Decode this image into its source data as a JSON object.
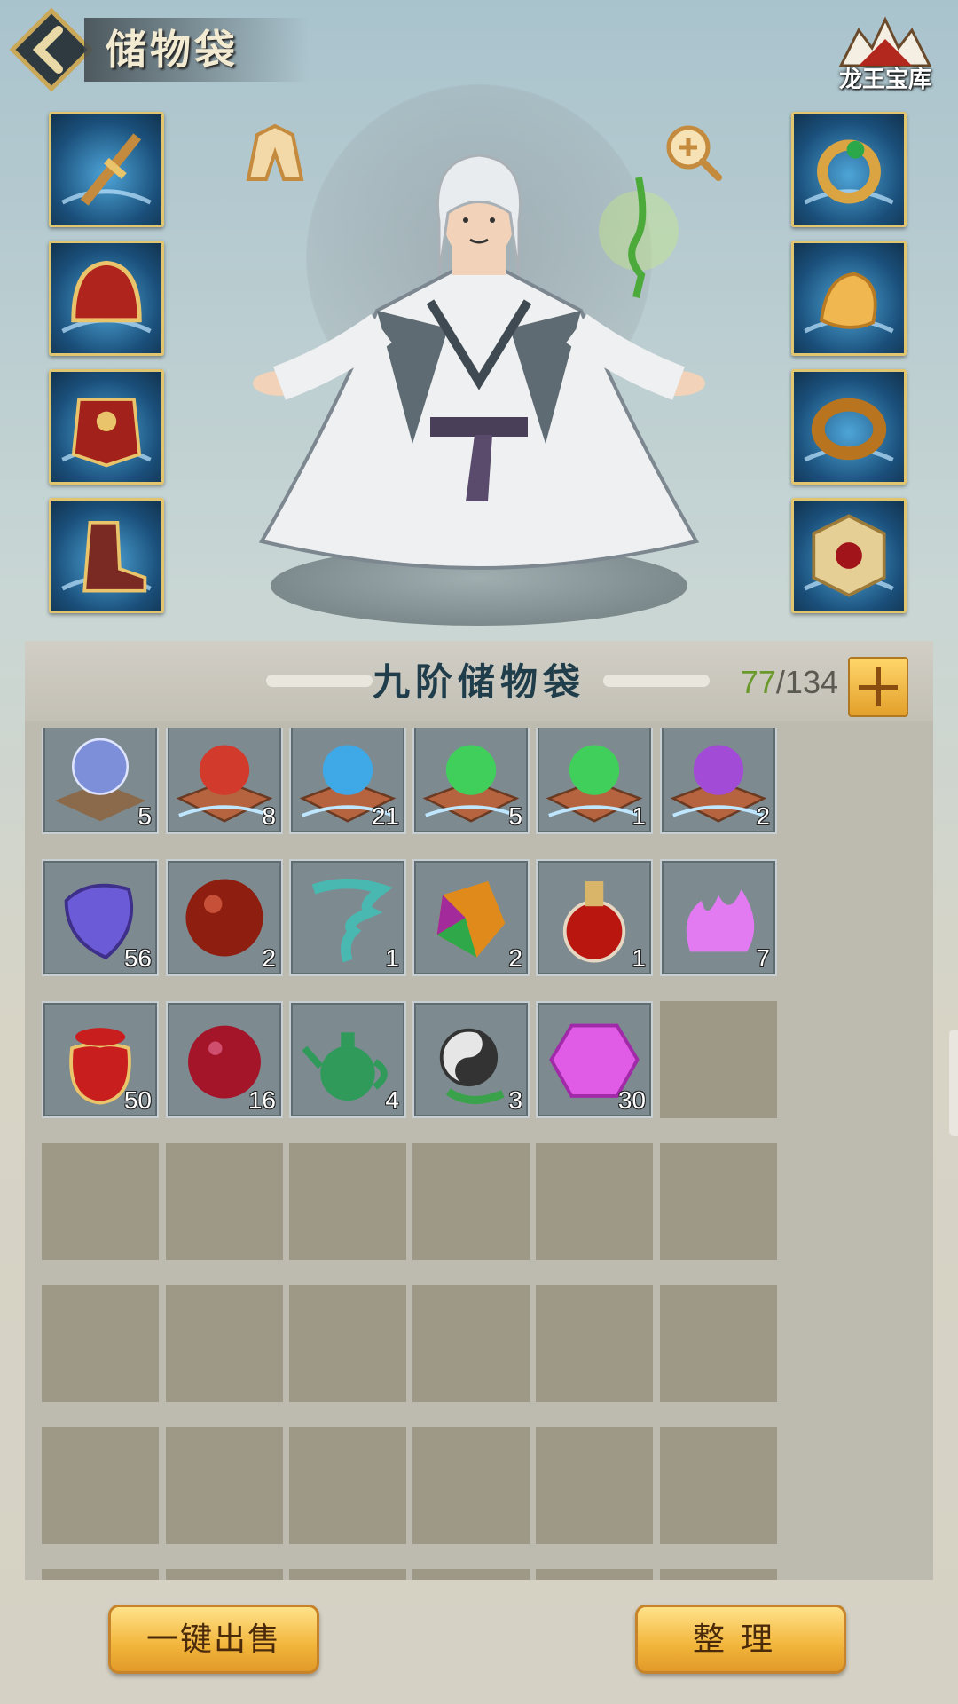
{
  "header": {
    "title": "储物袋",
    "treasury_label": "龙王宝库"
  },
  "equipment": {
    "left": [
      "sword",
      "helmet",
      "armor",
      "boots"
    ],
    "right": [
      "ring",
      "pendant",
      "bracelet",
      "amulet"
    ]
  },
  "bag": {
    "title": "九阶储物袋",
    "used": "77",
    "separator": "/",
    "capacity": "134",
    "rows": [
      [
        {
          "icon": "beast-orb",
          "qty": "5"
        },
        {
          "icon": "red-orb-book",
          "qty": "8"
        },
        {
          "icon": "blue-orb-book",
          "qty": "21"
        },
        {
          "icon": "green-orb-book",
          "qty": "5"
        },
        {
          "icon": "green-orb-book",
          "qty": "1"
        },
        {
          "icon": "purple-orb-book",
          "qty": "2"
        }
      ],
      [
        {
          "icon": "purple-stone",
          "qty": "56"
        },
        {
          "icon": "red-pearl",
          "qty": "2"
        },
        {
          "icon": "whirlwind",
          "qty": "1"
        },
        {
          "icon": "rainbow-gem",
          "qty": "2"
        },
        {
          "icon": "potion",
          "qty": "1"
        },
        {
          "icon": "purple-flame",
          "qty": "7"
        }
      ],
      [
        {
          "icon": "lucky-bag",
          "qty": "50"
        },
        {
          "icon": "crimson-orb",
          "qty": "16"
        },
        {
          "icon": "jade-teapot",
          "qty": "4"
        },
        {
          "icon": "yin-yang-gourd",
          "qty": "3"
        },
        {
          "icon": "rune-crystal",
          "qty": "30"
        },
        null
      ],
      [
        null,
        null,
        null,
        null,
        null,
        null
      ],
      [
        null,
        null,
        null,
        null,
        null,
        null
      ],
      [
        null,
        null,
        null,
        null,
        null,
        null
      ],
      [
        null,
        null,
        null,
        null,
        null,
        null
      ]
    ]
  },
  "buttons": {
    "sell_all": "一键出售",
    "sort": "整理"
  },
  "colors": {
    "gold_border": "#e1c56f",
    "used_count": "#6a9a2b",
    "empty_slot": "#9e9987"
  }
}
